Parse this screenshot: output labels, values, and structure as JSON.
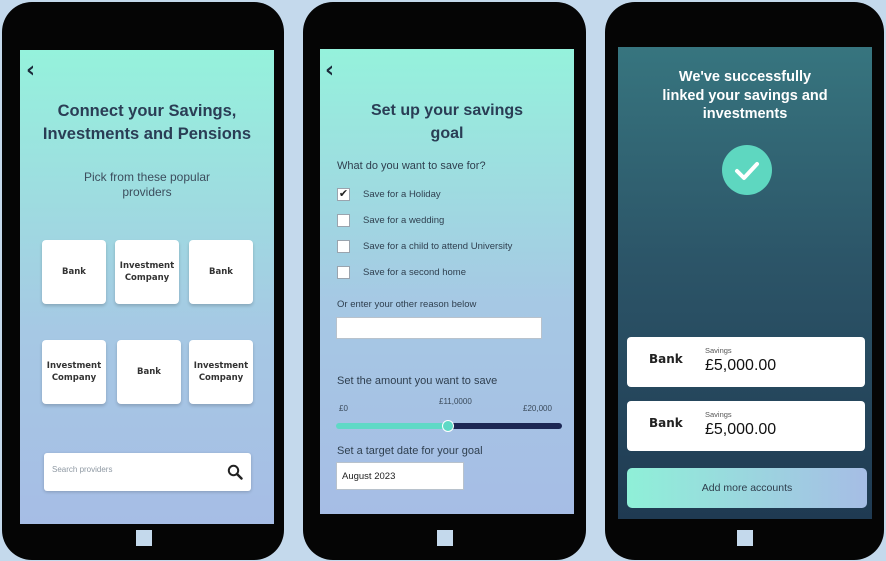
{
  "screen1": {
    "back_icon": "chevron-left",
    "title_line1": "Connect your Savings,",
    "title_line2": "Investments and Pensions",
    "subtitle_line1": "Pick from these popular",
    "subtitle_line2": "providers",
    "tiles": [
      {
        "line1": "Bank",
        "line2": ""
      },
      {
        "line1": "Investment",
        "line2": "Company"
      },
      {
        "line1": "Bank",
        "line2": ""
      },
      {
        "line1": "Investment",
        "line2": "Company"
      },
      {
        "line1": "Bank",
        "line2": ""
      },
      {
        "line1": "Investment",
        "line2": "Company"
      }
    ],
    "search_placeholder": "Search providers",
    "search_icon": "magnifier"
  },
  "screen2": {
    "back_icon": "chevron-left",
    "title_line1": "Set up your savings",
    "title_line2": "goal",
    "question": "What do you want to save for?",
    "options": [
      {
        "label": "Save for a Holiday",
        "checked": true
      },
      {
        "label": "Save for a wedding",
        "checked": false
      },
      {
        "label": "Save for a child to attend University",
        "checked": false
      },
      {
        "label": "Save for a second home",
        "checked": false
      }
    ],
    "other_reason_label": "Or enter your other reason below",
    "other_reason_value": "",
    "amount_label": "Set the amount you want to save",
    "slider_min": "£0",
    "slider_value": "£11,0000",
    "slider_max": "£20,000",
    "slider_fraction": 0.5,
    "date_label": "Set a target date for your goal",
    "date_value": "August 2023"
  },
  "screen3": {
    "title_line1": "We've successfully",
    "title_line2": "linked your savings and",
    "title_line3": "investments",
    "success_icon": "checkmark",
    "accounts": [
      {
        "bank": "Bank",
        "type": "Savings",
        "amount": "£5,000.00"
      },
      {
        "bank": "Bank",
        "type": "Savings",
        "amount": "£5,000.00"
      }
    ],
    "add_button": "Add more accounts"
  },
  "colors": {
    "background": "#c4d9ec",
    "teal_accent": "#5ed7c0",
    "slider_track_dark": "#1c2754",
    "title_text": "#2a3d55"
  }
}
